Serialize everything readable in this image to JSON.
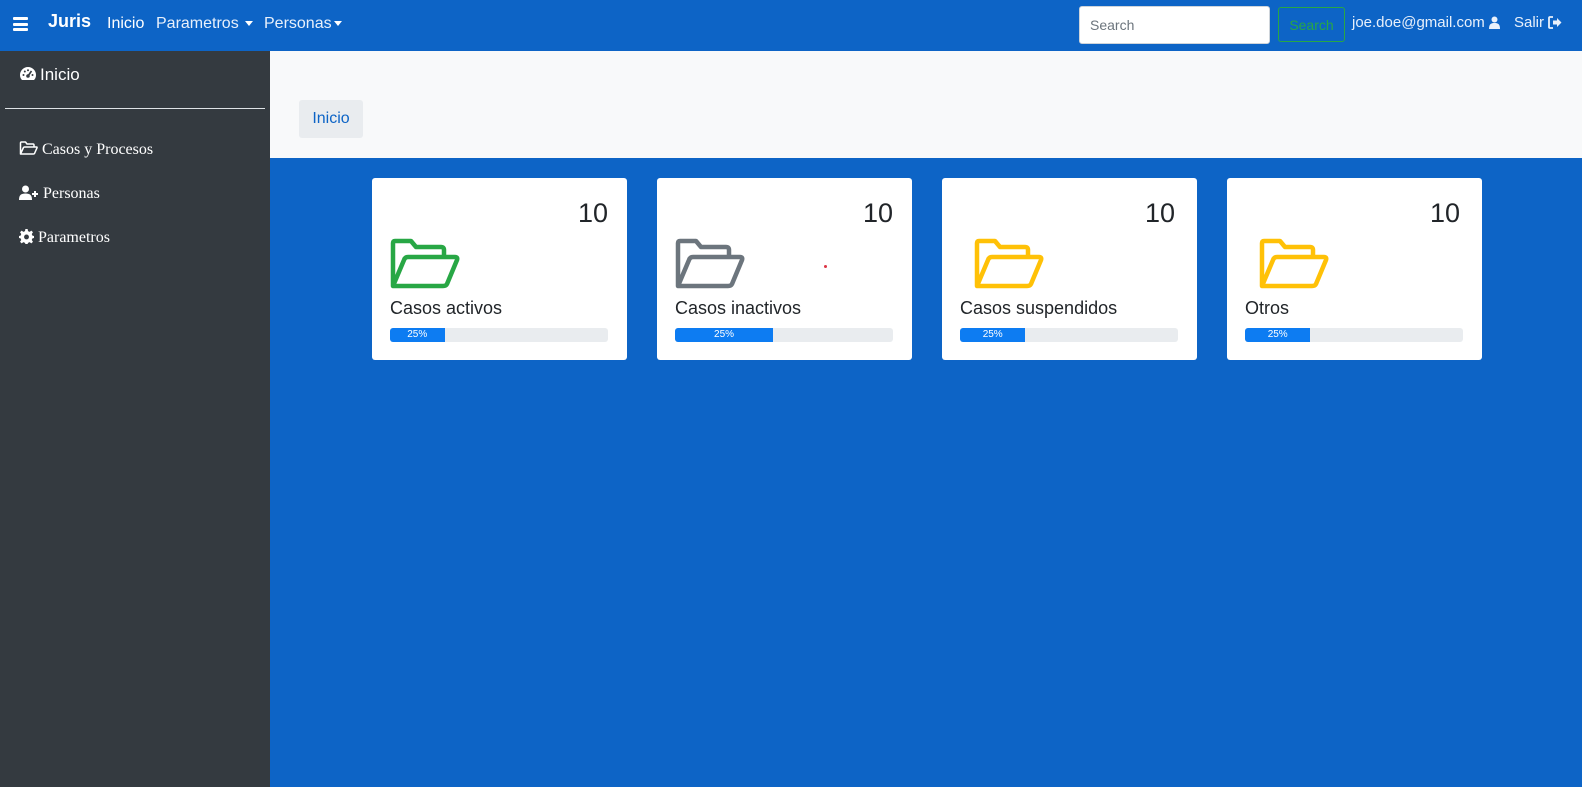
{
  "navbar": {
    "brand": "Juris",
    "links": [
      {
        "label": "Inicio",
        "dropdown": false
      },
      {
        "label": "Parametros",
        "dropdown": true
      },
      {
        "label": "Personas",
        "dropdown": true
      }
    ],
    "search": {
      "placeholder": "Search",
      "value": "",
      "button_label": "Search"
    },
    "user_email": "joe.doe@gmail.com",
    "logout_label": "Salir"
  },
  "sidebar": {
    "home": {
      "label": "Inicio",
      "icon": "dashboard-icon"
    },
    "items": [
      {
        "label": "Casos y Procesos",
        "icon": "folder-open-icon"
      },
      {
        "label": "Personas",
        "icon": "user-plus-icon"
      },
      {
        "label": "Parametros",
        "icon": "gear-icon"
      }
    ]
  },
  "breadcrumb": {
    "items": [
      "Inicio"
    ]
  },
  "cards": [
    {
      "count": "10",
      "label": "Casos activos",
      "progress": 0.25,
      "progress_label": "25%",
      "icon": "folder-open-icon",
      "icon_color": "#28a745"
    },
    {
      "count": "10",
      "label": "Casos inactivos",
      "progress": 0.45,
      "progress_label": "25%",
      "icon": "folder-open-icon",
      "icon_color": "#6c757d"
    },
    {
      "count": "10",
      "label": "Casos suspendidos",
      "progress": 0.3,
      "progress_label": "25%",
      "icon": "folder-open-icon",
      "icon_color": "#ffc107"
    },
    {
      "count": "10",
      "label": "Otros",
      "progress": 0.3,
      "progress_label": "25%",
      "icon": "folder-open-icon",
      "icon_color": "#ffc107"
    }
  ],
  "colors": {
    "primary": "#0d64c6",
    "sidebar": "#343a40",
    "progress": "#0d7cf2",
    "success": "#28a745"
  }
}
